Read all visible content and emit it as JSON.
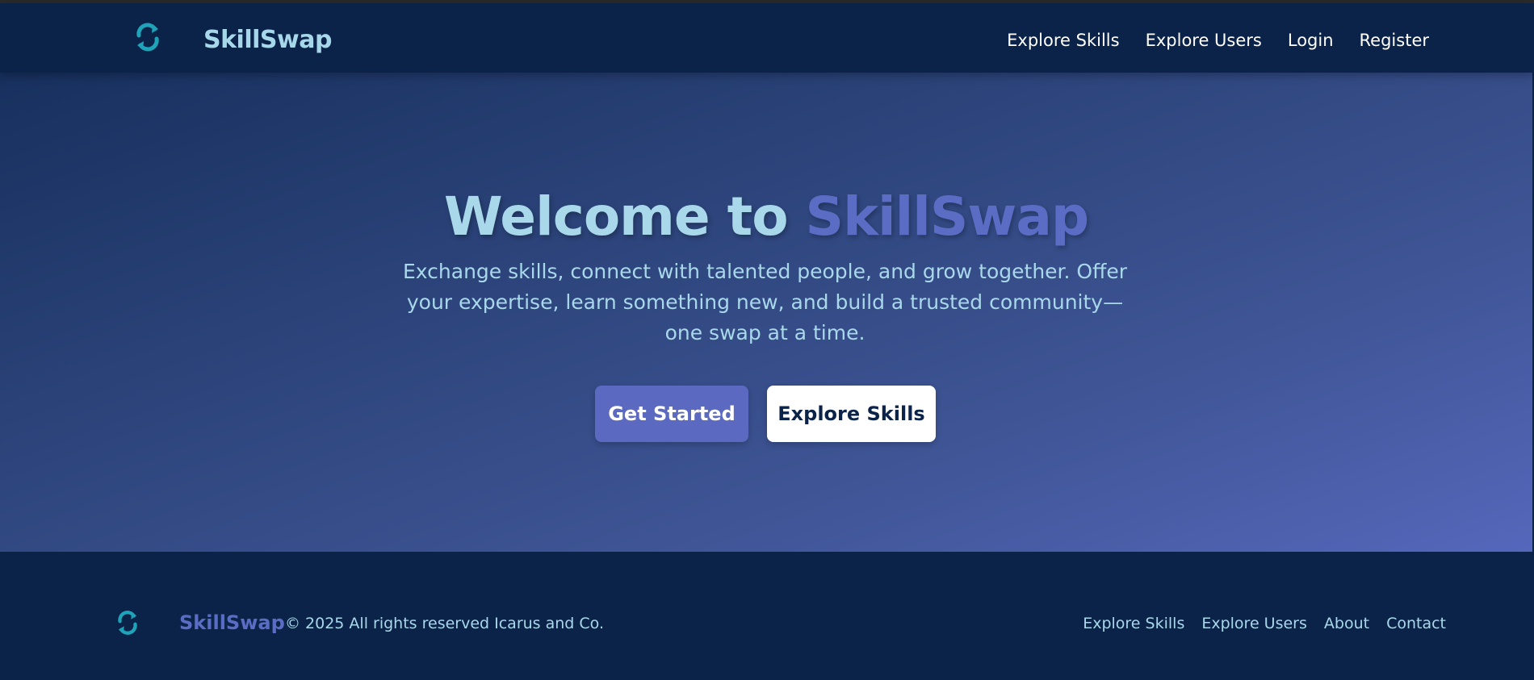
{
  "header": {
    "brand": "SkillSwap",
    "nav": [
      "Explore Skills",
      "Explore Users",
      "Login",
      "Register"
    ]
  },
  "hero": {
    "title_prefix": "Welcome to ",
    "title_accent": "SkillSwap",
    "description": "Exchange skills, connect with talented people, and grow together. Offer your expertise, learn something new, and build a trusted community—one swap at a time.",
    "primary_button": "Get Started",
    "secondary_button": "Explore Skills"
  },
  "footer": {
    "brand": "SkillSwap",
    "copyright": "© 2025 All rights reserved Icarus and Co.",
    "links": [
      "Explore Skills",
      "Explore Users",
      "About",
      "Contact"
    ]
  },
  "colors": {
    "navy": "#0b2349",
    "light_blue": "#a8d8ea",
    "accent": "#5b6cc4",
    "teal_icon": "#1fa3b8"
  },
  "icons": {
    "logo": "swap-arrows-icon"
  }
}
